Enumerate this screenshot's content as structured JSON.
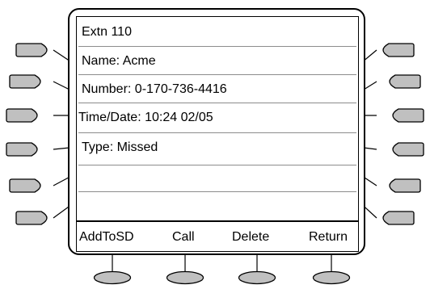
{
  "display": {
    "lines": [
      "Extn 110",
      "Name: Acme",
      "Number: 0-170-736-4416",
      "Time/Date: 10:24 02/05",
      "Type: Missed",
      ""
    ],
    "softkeys": [
      "AddToSD",
      "Call",
      "Delete",
      "Return"
    ]
  },
  "colors": {
    "key_fill": "#c0c0c0",
    "outline": "#000000",
    "separator": "#8c8c8c"
  }
}
